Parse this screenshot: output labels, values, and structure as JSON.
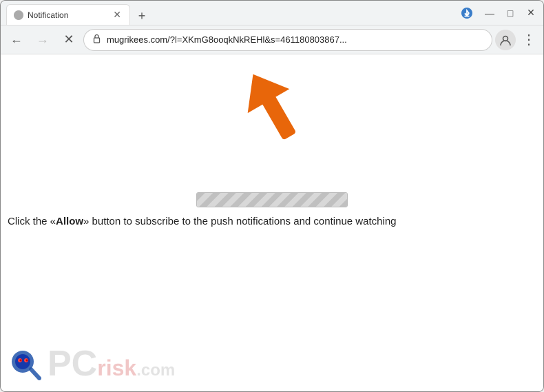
{
  "browser": {
    "tab": {
      "title": "Notification",
      "favicon": "🌐"
    },
    "window_controls": {
      "minimize": "—",
      "maximize": "□",
      "close": "✕"
    },
    "new_tab_icon": "+",
    "address": "mugrikees.com/?l=XKmG8ooqkNkREHl&s=461180803867...",
    "lock_icon": "🔒",
    "nav": {
      "back": "←",
      "forward": "→",
      "reload_stop": "✕"
    }
  },
  "page": {
    "instruction": "Click the «Allow» button to subscribe to the push notifications and continue watching",
    "instruction_prefix": "Click the «",
    "instruction_allow": "Allow",
    "instruction_suffix": "» button to subscribe to the push notifications and continue watching"
  },
  "watermark": {
    "pc_text": "PC",
    "risk_text": "risk",
    "domain": ".com"
  },
  "profile_icon": "👤",
  "menu_icon": "⋮",
  "star_icon": "☆",
  "download_icon": "⬇"
}
